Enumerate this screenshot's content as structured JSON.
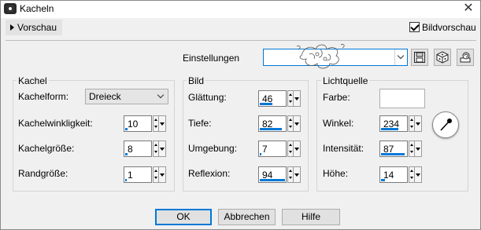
{
  "window": {
    "title": "Kacheln",
    "close_glyph": "✕"
  },
  "preview": {
    "toggle_label": "Vorschau",
    "checkbox_label": "Bildvorschau",
    "checked": true
  },
  "settings": {
    "label": "Einstellungen",
    "value": ""
  },
  "toolbar_icons": [
    "save-preset-icon",
    "random-dice-icon",
    "reset-preset-icon"
  ],
  "kachel": {
    "title": "Kachel",
    "kachelform_label": "Kachelform:",
    "kachelform_value": "Dreieck",
    "winkel_label": "Kachelwinkligkeit:",
    "winkel_value": "10",
    "winkel_fill": 0.1,
    "groesse_label": "Kachelgröße:",
    "groesse_value": "8",
    "groesse_fill": 0.08,
    "rand_label": "Randgröße:",
    "rand_value": "1",
    "rand_fill": 0.01
  },
  "bild": {
    "title": "Bild",
    "glaettung_label": "Glättung:",
    "glaettung_value": "46",
    "glaettung_fill": 0.46,
    "tiefe_label": "Tiefe:",
    "tiefe_value": "82",
    "tiefe_fill": 0.82,
    "umgebung_label": "Umgebung:",
    "umgebung_value": "7",
    "umgebung_fill": 0.07,
    "reflexion_label": "Reflexion:",
    "reflexion_value": "94",
    "reflexion_fill": 0.94
  },
  "licht": {
    "title": "Lichtquelle",
    "farbe_label": "Farbe:",
    "farbe_value": "#ffffff",
    "winkel_label": "Winkel:",
    "winkel_value": "234",
    "winkel_fill": 0.65,
    "intensitaet_label": "Intensität:",
    "intensitaet_value": "87",
    "intensitaet_fill": 0.87,
    "hoehe_label": "Höhe:",
    "hoehe_value": "14",
    "hoehe_fill": 0.14
  },
  "buttons": {
    "ok": "OK",
    "cancel": "Abbrechen",
    "help": "Hilfe"
  },
  "colors": {
    "accent": "#0078d7",
    "panel": "#f0f0f0",
    "border": "#d5d5d5"
  }
}
